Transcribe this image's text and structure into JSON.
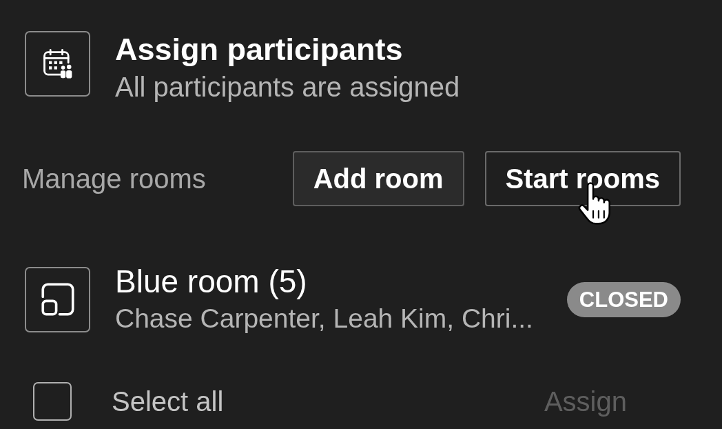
{
  "header": {
    "title": "Assign participants",
    "subtitle": "All participants are assigned"
  },
  "manage": {
    "label": "Manage rooms",
    "buttons": [
      {
        "label": "Add room",
        "kind": "filled"
      },
      {
        "label": "Start rooms",
        "kind": "outline"
      }
    ]
  },
  "rooms": [
    {
      "name": "Blue room (5)",
      "participants": "Chase Carpenter, Leah Kim, Chri...",
      "status": "CLOSED"
    }
  ],
  "selection": {
    "label": "Select all",
    "checked": false,
    "action": {
      "label": "Assign",
      "disabled": true
    }
  }
}
